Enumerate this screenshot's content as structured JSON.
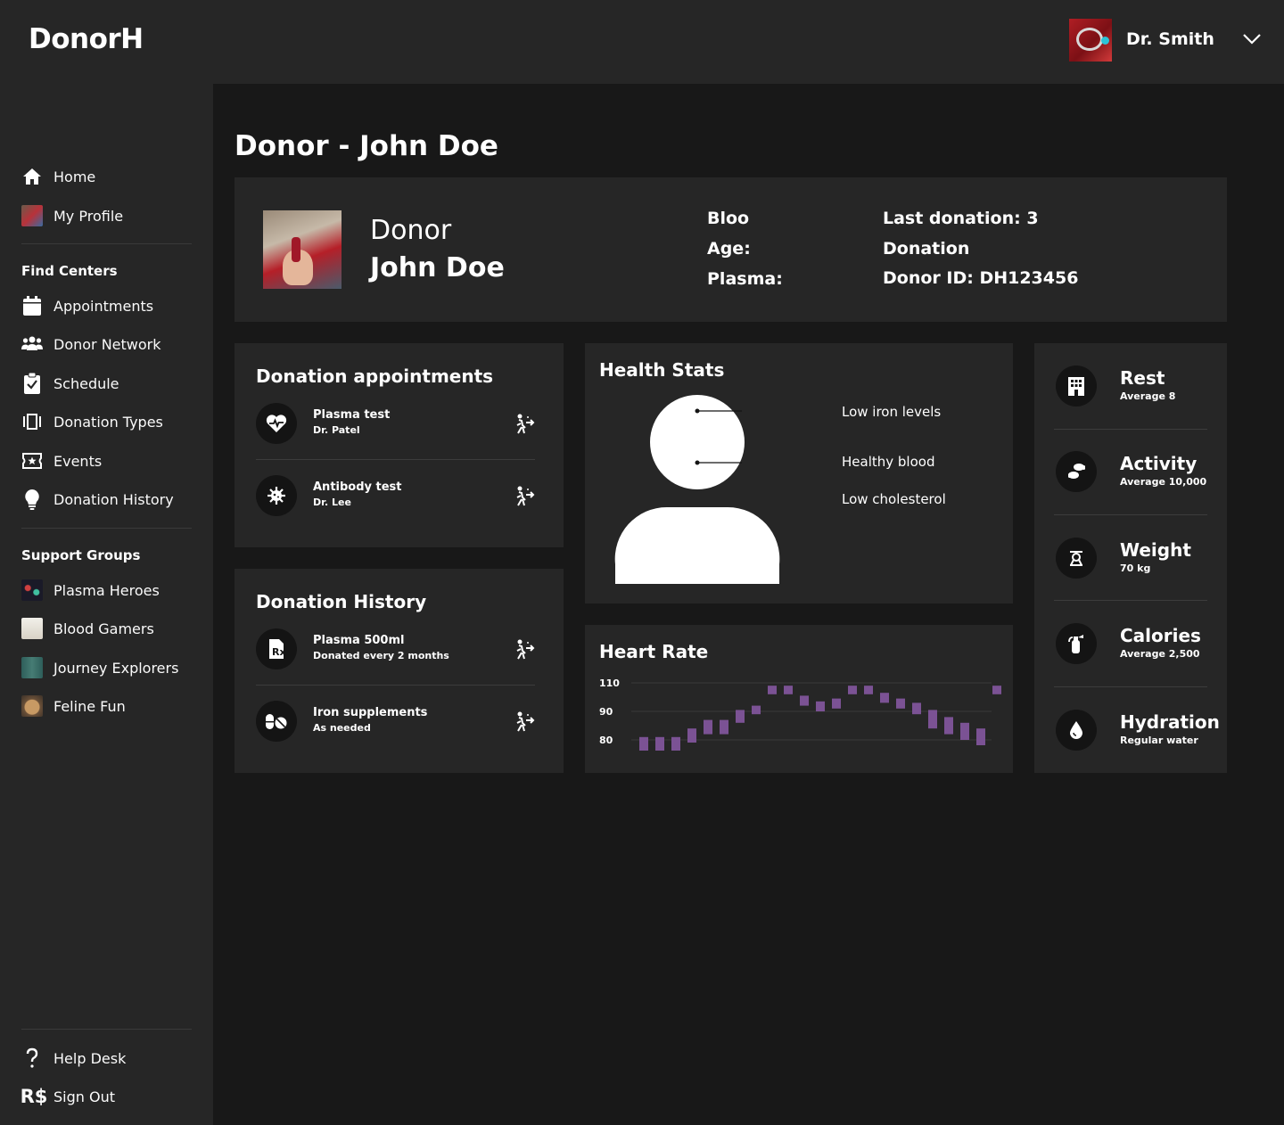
{
  "app": {
    "name": "DonorH"
  },
  "user": {
    "name": "Dr. Smith"
  },
  "sidebar": {
    "top_items": [
      {
        "label": "Home",
        "icon": "home-icon"
      },
      {
        "label": "My Profile",
        "icon": "profile-thumbnail"
      }
    ],
    "find_centers": {
      "title": "Find Centers",
      "items": [
        {
          "label": "Appointments",
          "icon": "calendar-icon"
        },
        {
          "label": "Donor Network",
          "icon": "users-icon"
        },
        {
          "label": "Schedule",
          "icon": "clipboard-check-icon"
        },
        {
          "label": "Donation Types",
          "icon": "carousel-icon"
        },
        {
          "label": "Events",
          "icon": "ticket-icon"
        },
        {
          "label": "Donation History",
          "icon": "lightbulb-icon"
        }
      ]
    },
    "support_groups": {
      "title": "Support Groups",
      "items": [
        {
          "label": "Plasma Heroes"
        },
        {
          "label": "Blood Gamers"
        },
        {
          "label": "Journey Explorers"
        },
        {
          "label": "Feline Fun"
        }
      ]
    },
    "bottom_items": [
      {
        "label": "Help Desk",
        "icon": "question-icon"
      },
      {
        "label": "Sign Out",
        "icon": "real-currency-icon"
      }
    ]
  },
  "page": {
    "title": "Donor - John Doe"
  },
  "profile": {
    "label": "Donor",
    "name": "John Doe",
    "col1": [
      "Bloo",
      "Age:",
      "Plasma:"
    ],
    "col2": [
      "Last donation: 3",
      "Donation",
      "Donor ID: DH123456"
    ]
  },
  "appointments": {
    "title": "Donation appointments",
    "items": [
      {
        "title": "Plasma test",
        "sub": "Dr. Patel",
        "icon": "heart-pulse-icon"
      },
      {
        "title": "Antibody test",
        "sub": "Dr. Lee",
        "icon": "virus-icon"
      }
    ]
  },
  "history": {
    "title": "Donation History",
    "items": [
      {
        "title": "Plasma 500ml",
        "sub": "Donated every 2 months",
        "icon": "prescription-icon"
      },
      {
        "title": "Iron supplements",
        "sub": "As needed",
        "icon": "pills-icon"
      }
    ]
  },
  "health_stats": {
    "title": "Health Stats",
    "labels": [
      "Low iron levels",
      "Healthy blood",
      "Low cholesterol"
    ]
  },
  "heart_rate": {
    "title": "Heart Rate",
    "color": "#7b5294"
  },
  "stats": {
    "items": [
      {
        "title": "Rest",
        "sub": "Average 8",
        "icon": "building-icon"
      },
      {
        "title": "Activity",
        "sub": "Average 10,000",
        "icon": "footprints-icon"
      },
      {
        "title": "Weight",
        "sub": "70 kg",
        "icon": "scale-icon"
      },
      {
        "title": "Calories",
        "sub": "Average 2,500",
        "icon": "fire-extinguisher-icon"
      },
      {
        "title": "Hydration",
        "sub": "Regular water",
        "icon": "droplet-icon"
      }
    ]
  },
  "chart_data": {
    "type": "bar",
    "title": "Heart Rate",
    "xlabel": "",
    "ylabel": "",
    "yticks": [
      80,
      90,
      110
    ],
    "grid": true,
    "series": [
      {
        "values": [
          [
            76,
            81
          ],
          [
            76,
            81
          ],
          [
            76,
            81
          ],
          [
            79,
            84
          ],
          [
            82,
            87
          ],
          [
            82,
            87
          ],
          [
            86,
            91
          ],
          [
            89,
            94
          ],
          [
            102,
            108
          ],
          [
            102,
            108
          ],
          [
            94,
            101
          ],
          [
            90,
            97
          ],
          [
            92,
            99
          ],
          [
            102,
            108
          ],
          [
            102,
            108
          ],
          [
            96,
            103
          ],
          [
            92,
            99
          ],
          [
            89,
            96
          ],
          [
            84,
            91
          ],
          [
            82,
            88
          ],
          [
            80,
            86
          ],
          [
            78,
            84
          ],
          [
            102,
            108
          ]
        ]
      }
    ]
  }
}
